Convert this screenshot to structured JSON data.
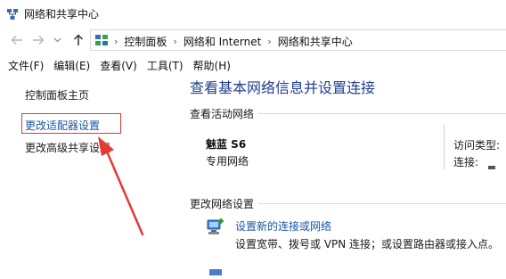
{
  "window": {
    "title": "网络和共享中心",
    "icon": "network-sharing-icon"
  },
  "navigation": {
    "back_icon": "arrow-left-icon",
    "forward_icon": "arrow-right-icon",
    "recent_icon": "chevron-down-icon",
    "up_icon": "arrow-up-icon",
    "breadcrumb": [
      "控制面板",
      "网络和 Internet",
      "网络和共享中心"
    ],
    "separator": "›"
  },
  "menubar": {
    "items": [
      "文件(F)",
      "编辑(E)",
      "查看(V)",
      "工具(T)",
      "帮助(H)"
    ]
  },
  "sidebar": {
    "home_link": "控制面板主页",
    "links": [
      "更改适配器设置",
      "更改高级共享设置"
    ],
    "highlighted_index": 0,
    "highlight_color": "#e53935",
    "arrow_color": "#e53935"
  },
  "main": {
    "title": "查看基本网络信息并设置连接",
    "title_color": "#1e3e8f",
    "active_networks": {
      "label": "查看活动网络",
      "network_name": "魅蓝 S6",
      "network_type": "专用网络",
      "access_type_label": "访问类型:",
      "connection_label": "连接:"
    },
    "change_settings": {
      "label": "更改网络设置",
      "items": [
        {
          "icon": "new-connection-icon",
          "link": "设置新的连接或网络",
          "description": "设置宽带、拨号或 VPN 连接；或设置路由器或接入点。"
        }
      ]
    }
  },
  "colors": {
    "link": "#1a56a8",
    "text": "#1a1a1a"
  }
}
